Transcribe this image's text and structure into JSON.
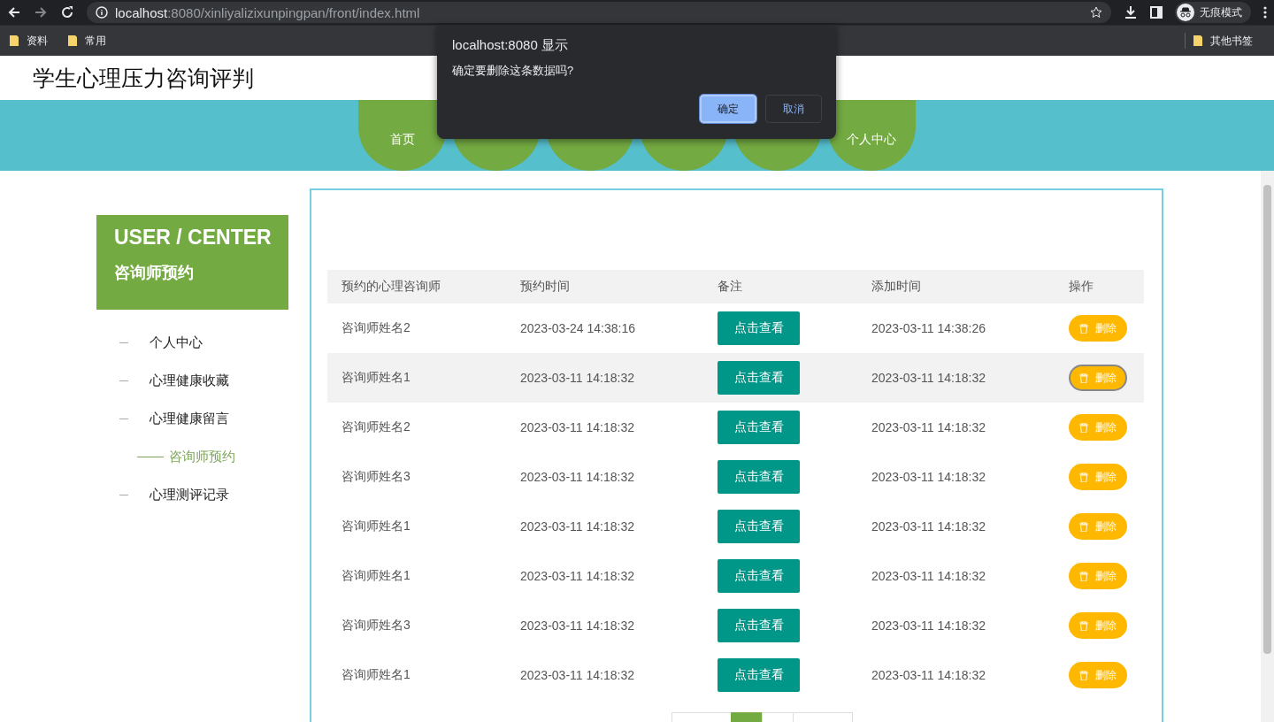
{
  "browser": {
    "url_host": "localhost",
    "url_path": ":8080/xinliyalizixunpingpan/front/index.html",
    "profile": "无痕模式",
    "bookmarks": [
      "资料",
      "常用"
    ],
    "other_bookmarks": "其他书签"
  },
  "site": {
    "title": "学生心理压力咨询评判"
  },
  "nav": [
    {
      "kind": "labeled",
      "label": "首页"
    },
    {
      "kind": "covered"
    },
    {
      "kind": "covered"
    },
    {
      "kind": "covered"
    },
    {
      "kind": "covered"
    },
    {
      "kind": "labeled",
      "label": "个人中心"
    }
  ],
  "sidebar": {
    "heading": "USER / CENTER",
    "subheading": "咨询师预约",
    "items": [
      {
        "label": "个人中心",
        "selected": false
      },
      {
        "label": "心理健康收藏",
        "selected": false
      },
      {
        "label": "心理健康留言",
        "selected": false
      },
      {
        "label": "咨询师预约",
        "selected": true
      },
      {
        "label": "心理测评记录",
        "selected": false
      }
    ]
  },
  "table": {
    "columns": [
      "预约的心理咨询师",
      "预约时间",
      "备注",
      "添加时间",
      "操作"
    ],
    "rows": [
      {
        "counselor": "咨询师姓名2",
        "time": "2023-03-24 14:38:16",
        "note": "点击查看",
        "added": "2023-03-11 14:38:26",
        "action": "删除",
        "highlighted": false
      },
      {
        "counselor": "咨询师姓名1",
        "time": "2023-03-11 14:18:32",
        "note": "点击查看",
        "added": "2023-03-11 14:18:32",
        "action": "删除",
        "highlighted": true
      },
      {
        "counselor": "咨询师姓名2",
        "time": "2023-03-11 14:18:32",
        "note": "点击查看",
        "added": "2023-03-11 14:18:32",
        "action": "删除",
        "highlighted": false
      },
      {
        "counselor": "咨询师姓名3",
        "time": "2023-03-11 14:18:32",
        "note": "点击查看",
        "added": "2023-03-11 14:18:32",
        "action": "删除",
        "highlighted": false
      },
      {
        "counselor": "咨询师姓名1",
        "time": "2023-03-11 14:18:32",
        "note": "点击查看",
        "added": "2023-03-11 14:18:32",
        "action": "删除",
        "highlighted": false
      },
      {
        "counselor": "咨询师姓名1",
        "time": "2023-03-11 14:18:32",
        "note": "点击查看",
        "added": "2023-03-11 14:18:32",
        "action": "删除",
        "highlighted": false
      },
      {
        "counselor": "咨询师姓名3",
        "time": "2023-03-11 14:18:32",
        "note": "点击查看",
        "added": "2023-03-11 14:18:32",
        "action": "删除",
        "highlighted": false
      },
      {
        "counselor": "咨询师姓名1",
        "time": "2023-03-11 14:18:32",
        "note": "点击查看",
        "added": "2023-03-11 14:18:32",
        "action": "删除",
        "highlighted": false
      }
    ]
  },
  "pagination": [
    {
      "selected": false
    },
    {
      "selected": true
    },
    {
      "selected": false
    },
    {
      "selected": false
    }
  ],
  "dialog": {
    "title": "localhost:8080 显示",
    "message": "确定要删除这条数据吗?",
    "buttons": [
      {
        "label": "确定",
        "kind": "primary"
      },
      {
        "label": "取消",
        "kind": "secondary"
      }
    ]
  }
}
